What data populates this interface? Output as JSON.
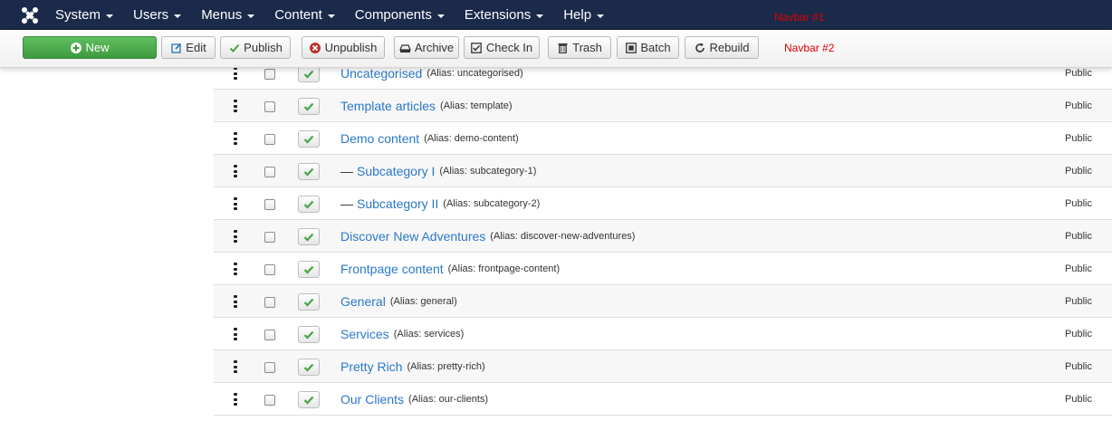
{
  "navbar1": {
    "menu": [
      {
        "label": "System"
      },
      {
        "label": "Users"
      },
      {
        "label": "Menus"
      },
      {
        "label": "Content"
      },
      {
        "label": "Components"
      },
      {
        "label": "Extensions"
      },
      {
        "label": "Help"
      }
    ],
    "annotation": "Navbar #1",
    "logo_icon": "joomla-logo-icon"
  },
  "toolbar": {
    "new": "New",
    "edit": "Edit",
    "publish": "Publish",
    "unpublish": "Unpublish",
    "archive": "Archive",
    "checkin": "Check In",
    "trash": "Trash",
    "batch": "Batch",
    "rebuild": "Rebuild",
    "annotation": "Navbar #2"
  },
  "colors": {
    "navbar_bg": "#1b2a4a",
    "new_button": "#4cae4c",
    "link": "#2a78c8",
    "annotation": "#e00000",
    "check_green": "#46a546"
  },
  "rows": [
    {
      "prefix": "",
      "title": "Uncategorised",
      "alias": "(Alias: uncategorised)",
      "access": "Public"
    },
    {
      "prefix": "",
      "title": "Template articles",
      "alias": "(Alias: template)",
      "access": "Public"
    },
    {
      "prefix": "",
      "title": "Demo content",
      "alias": "(Alias: demo-content)",
      "access": "Public"
    },
    {
      "prefix": "—",
      "title": "Subcategory I",
      "alias": "(Alias: subcategory-1)",
      "access": "Public"
    },
    {
      "prefix": "—",
      "title": "Subcategory II",
      "alias": "(Alias: subcategory-2)",
      "access": "Public"
    },
    {
      "prefix": "",
      "title": "Discover New Adventures",
      "alias": "(Alias: discover-new-adventures)",
      "access": "Public"
    },
    {
      "prefix": "",
      "title": "Frontpage content",
      "alias": "(Alias: frontpage-content)",
      "access": "Public"
    },
    {
      "prefix": "",
      "title": "General",
      "alias": "(Alias: general)",
      "access": "Public"
    },
    {
      "prefix": "",
      "title": "Services",
      "alias": "(Alias: services)",
      "access": "Public"
    },
    {
      "prefix": "",
      "title": "Pretty Rich",
      "alias": "(Alias: pretty-rich)",
      "access": "Public"
    },
    {
      "prefix": "",
      "title": "Our Clients",
      "alias": "(Alias: our-clients)",
      "access": "Public"
    }
  ]
}
